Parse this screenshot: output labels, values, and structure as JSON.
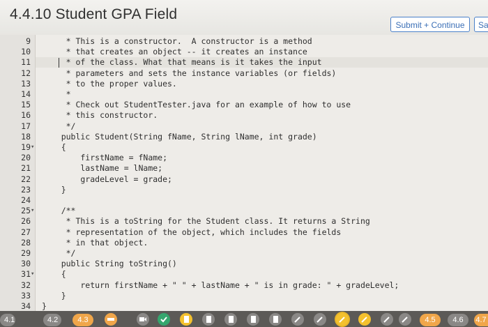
{
  "header": {
    "title": "4.4.10 Student GPA Field",
    "submit_label": "Submit + Continue",
    "save_label": "Sa"
  },
  "editor": {
    "line_numbers": [
      "9",
      "10",
      "11",
      "12",
      "13",
      "14",
      "15",
      "16",
      "17",
      "18",
      "19",
      "20",
      "21",
      "22",
      "23",
      "24",
      "25",
      "26",
      "27",
      "28",
      "29",
      "30",
      "31",
      "32",
      "33",
      "34"
    ],
    "fold_markers": {
      "19": "▾",
      "25": "▾",
      "31": "▾"
    },
    "lines": [
      "     * This is a constructor.  A constructor is a method",
      "     * that creates an object -- it creates an instance",
      "     * of the class. What that means is it takes the input",
      "     * parameters and sets the instance variables (or fields)",
      "     * to the proper values.",
      "     *",
      "     * Check out StudentTester.java for an example of how to use",
      "     * this constructor.",
      "     */",
      "    public Student(String fName, String lName, int grade)",
      "    {",
      "        firstName = fName;",
      "        lastName = lName;",
      "        gradeLevel = grade;",
      "    }",
      "",
      "    /**",
      "     * This is a toString for the Student class. It returns a String",
      "     * representation of the object, which includes the fields",
      "     * in that object.",
      "     */",
      "    public String toString()",
      "    {",
      "        return firstName + \" \" + lastName + \" is in grade: \" + gradeLevel;",
      "    }",
      "}"
    ]
  },
  "footer": {
    "tabs": [
      {
        "label": "4.1",
        "color": "#8a8886"
      },
      {
        "label": "4.2",
        "color": "#8a8886"
      },
      {
        "label": "4.3",
        "color": "#f0a64a"
      },
      {
        "label": "4.5",
        "color": "#f0a64a"
      },
      {
        "label": "4.6",
        "color": "#8a8886"
      },
      {
        "label": "4.7",
        "color": "#f0a64a"
      }
    ],
    "accent_orange": "#f0a64a",
    "accent_green": "#35a66e",
    "accent_yellow": "#f4c12e",
    "icons": [
      "video-icon",
      "check-icon",
      "doc-icon",
      "doc-icon",
      "doc-icon",
      "doc-icon",
      "doc-icon",
      "doc-icon",
      "pencil-icon",
      "pencil-icon",
      "pencil-icon",
      "pencil-icon",
      "pencil-icon",
      "pencil-icon",
      "pencil-icon"
    ]
  }
}
